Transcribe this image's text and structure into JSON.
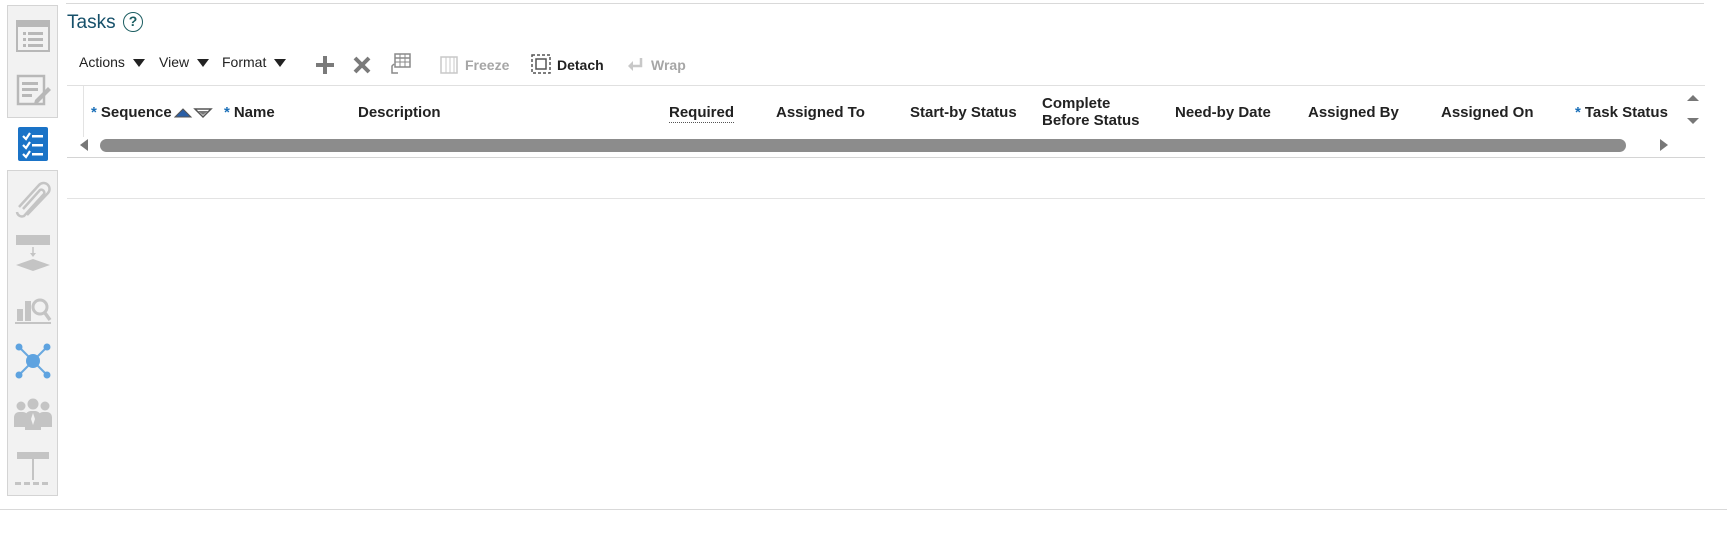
{
  "header": {
    "title": "Tasks",
    "help_symbol": "?"
  },
  "rail": {
    "items": [
      {
        "icon": "list-document-icon",
        "active": false
      },
      {
        "icon": "edit-document-icon",
        "active": false
      },
      {
        "icon": "task-checklist-icon",
        "active": true
      },
      {
        "icon": "paperclip-icon",
        "active": false
      },
      {
        "icon": "workflow-diagram-icon",
        "active": false
      },
      {
        "icon": "search-analytics-icon",
        "active": false
      },
      {
        "icon": "network-hub-icon",
        "active": false
      },
      {
        "icon": "people-group-icon",
        "active": false
      },
      {
        "icon": "hierarchy-icon",
        "active": false
      }
    ]
  },
  "toolbar": {
    "actions_label": "Actions",
    "view_label": "View",
    "format_label": "Format",
    "freeze_label": "Freeze",
    "detach_label": "Detach",
    "wrap_label": "Wrap"
  },
  "table": {
    "columns": {
      "sequence": {
        "label": "Sequence",
        "required": "*"
      },
      "name": {
        "label": "Name",
        "required": "*"
      },
      "description": {
        "label": "Description"
      },
      "required": {
        "label": "Required"
      },
      "assigned_to": {
        "label": "Assigned To"
      },
      "start_by_status": {
        "label": "Start-by Status"
      },
      "complete_before_status_line1": {
        "label": "Complete"
      },
      "complete_before_status_line2": {
        "label": "Before Status"
      },
      "need_by_date": {
        "label": "Need-by Date"
      },
      "assigned_by": {
        "label": "Assigned By"
      },
      "assigned_on": {
        "label": "Assigned On"
      },
      "task_status": {
        "label": "Task Status",
        "required": "*"
      }
    },
    "rows": []
  },
  "colors": {
    "title": "#16506a",
    "required_marker": "#1a6fb8",
    "active_rail_icon": "#1a73c7",
    "disabled_text": "#a6a6a6",
    "scroll_thumb": "#8c8c8c"
  }
}
